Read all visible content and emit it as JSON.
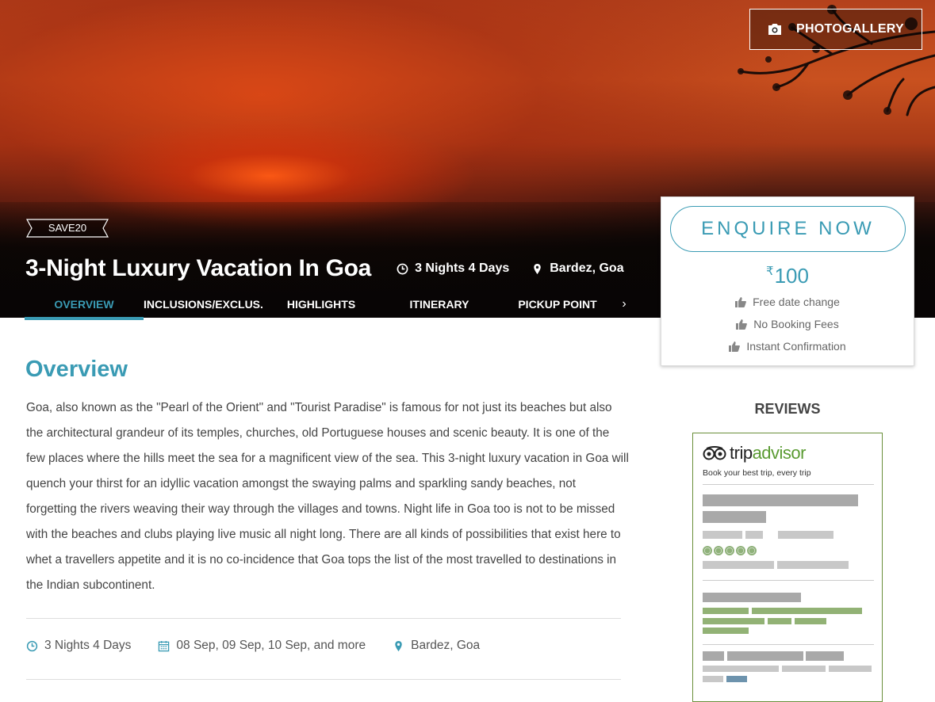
{
  "hero": {
    "photogallery_label": "PHOTOGALLERY",
    "save_tag": "SAVE20",
    "title": "3-Night Luxury Vacation In Goa",
    "duration": "3 Nights 4 Days",
    "location": "Bardez, Goa"
  },
  "tabs": [
    {
      "label": "OVERVIEW",
      "active": true
    },
    {
      "label": "INCLUSIONS/EXCLUS...",
      "active": false
    },
    {
      "label": "HIGHLIGHTS",
      "active": false
    },
    {
      "label": "ITINERARY",
      "active": false
    },
    {
      "label": "PICKUP POINT",
      "active": false
    }
  ],
  "tab_next_icon": "chevron-right-icon",
  "enquire": {
    "button_label": "ENQUIRE NOW",
    "currency_symbol": "₹",
    "price": "100",
    "features": [
      "Free date change",
      "No Booking Fees",
      "Instant Confirmation"
    ],
    "feature_icon": "thumbs-up-icon"
  },
  "overview": {
    "title": "Overview",
    "text": "Goa, also known as the \"Pearl of the Orient\" and \"Tourist Paradise\" is famous for not just its beaches but also the architectural grandeur of its temples, churches, old Portuguese houses and scenic beauty. It is one of the few places where the hills meet the sea for a magnificent view of the sea. This 3-night luxury vacation in Goa will quench your thirst for an idyllic vacation amongst the swaying palms and sparkling sandy beaches, not forgetting the rivers weaving their way through the villages and towns. Night life in Goa too is not to be missed with the beaches and clubs playing live music all night long. There are all kinds of possibilities that exist here to whet a travellers appetite and it is no co-incidence that Goa tops the list of the most travelled to destinations in the Indian subcontinent.",
    "info": {
      "duration": "3 Nights 4 Days",
      "dates": "08 Sep, 09 Sep, 10 Sep, and more",
      "location": "Bardez, Goa"
    }
  },
  "reviews": {
    "title": "REVIEWS",
    "brand_trip": "trip",
    "brand_advisor": "advisor",
    "tagline": "Book your best trip, every trip"
  },
  "colors": {
    "accent": "#3a9bb4",
    "tripadvisor_green": "#5a9b32"
  }
}
